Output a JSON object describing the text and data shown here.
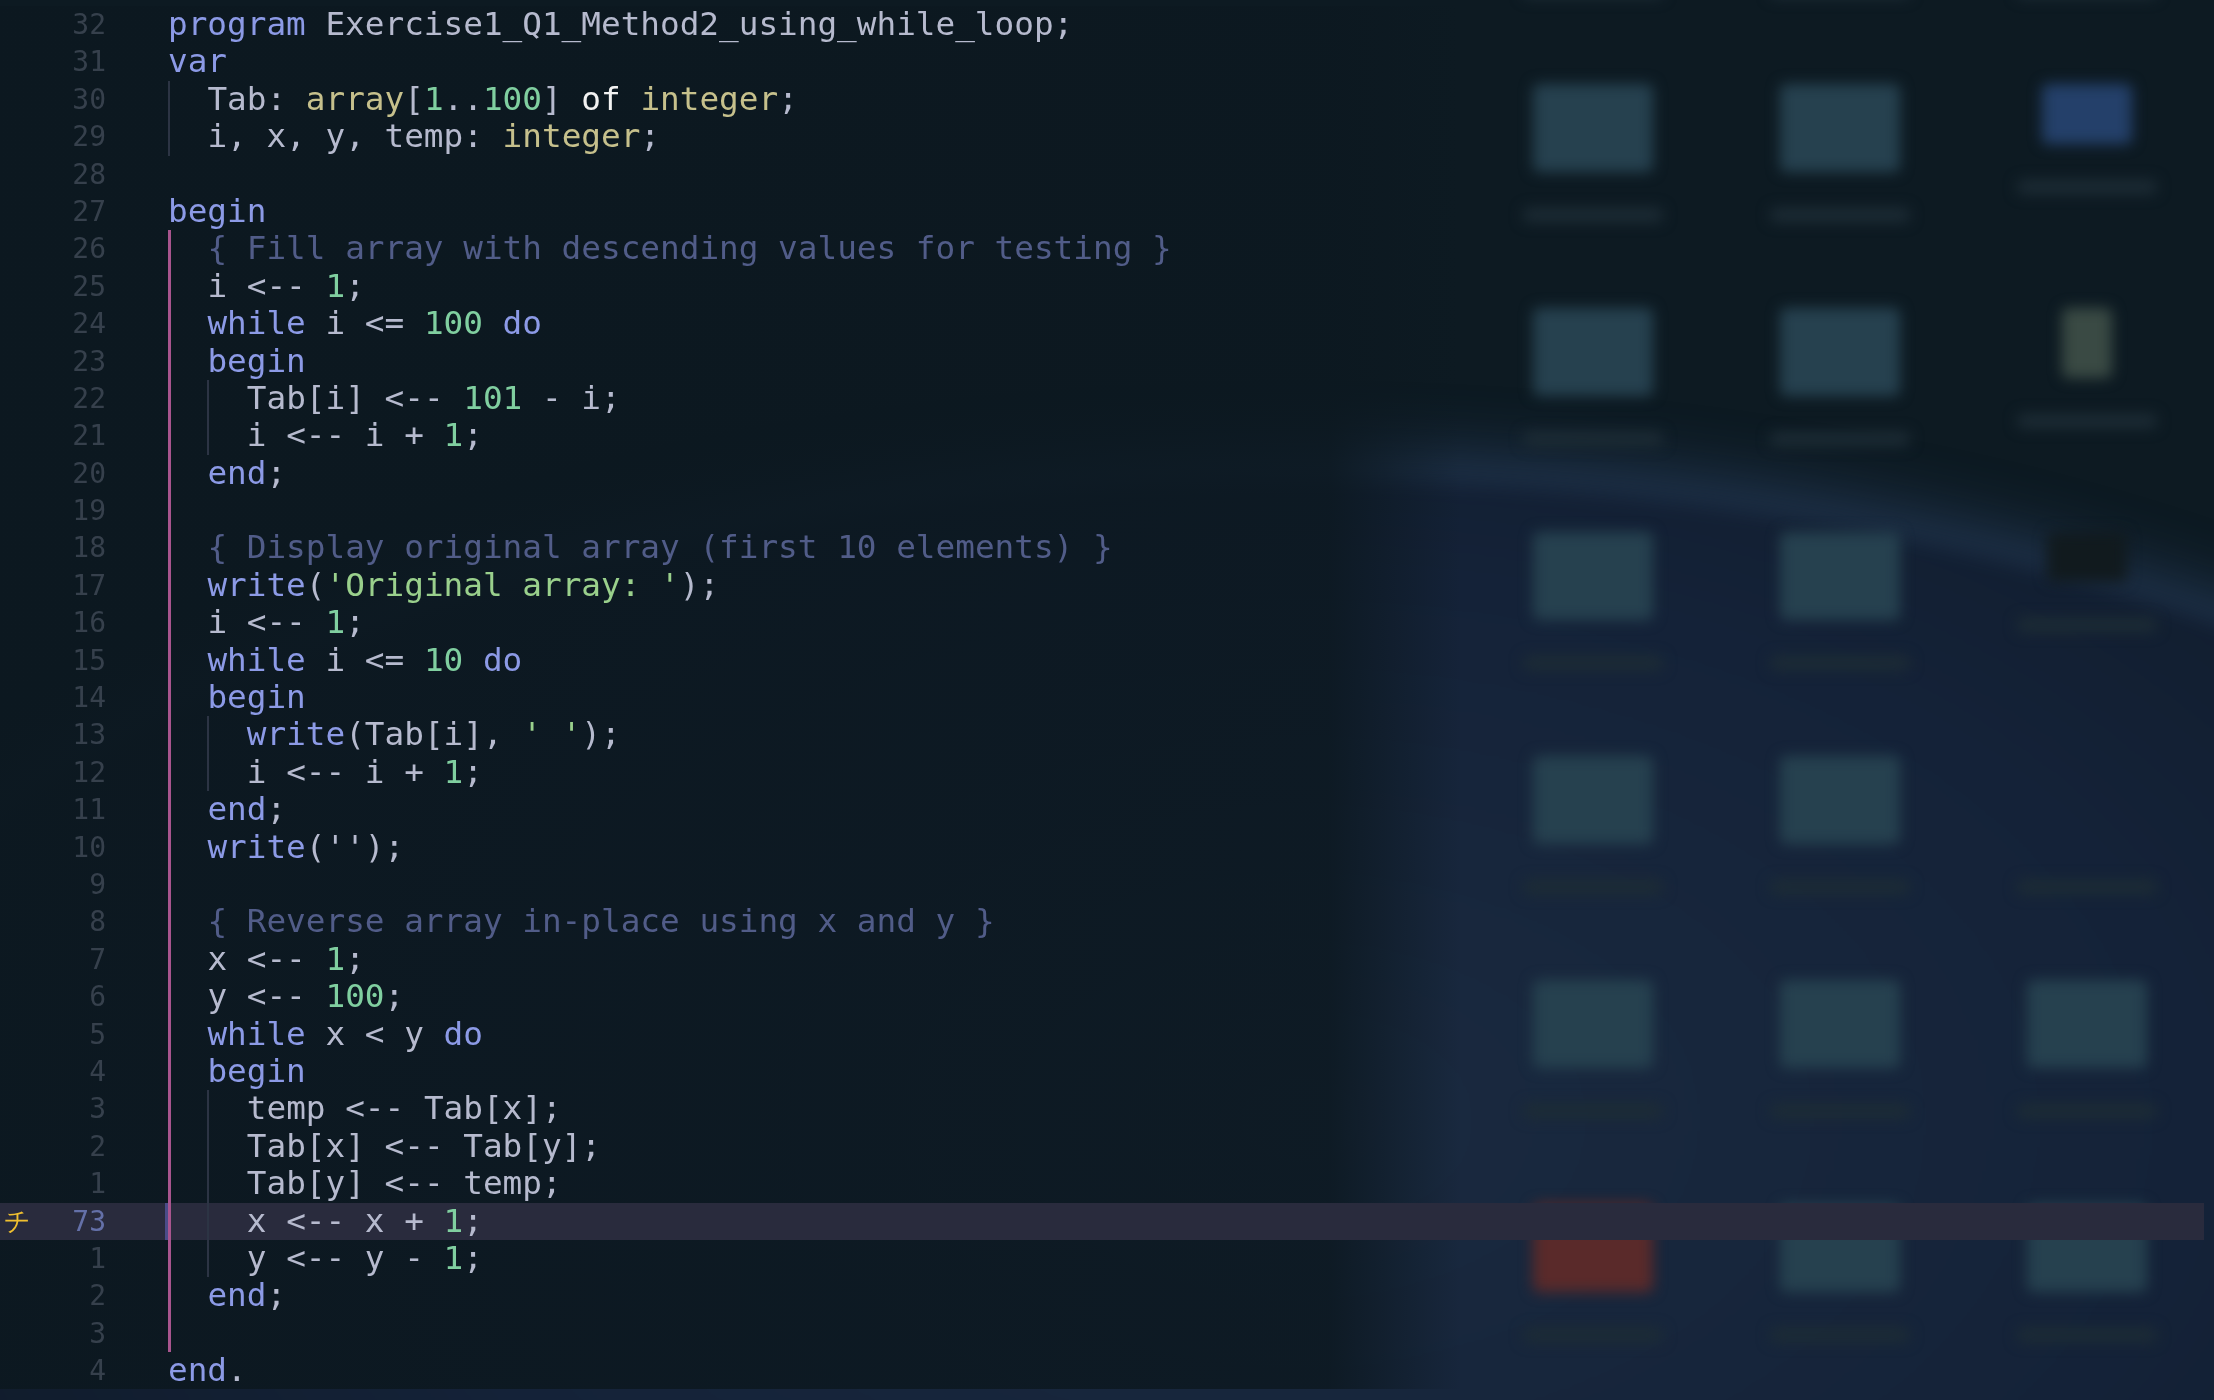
{
  "editor": {
    "lines": [
      {
        "number": "32",
        "selected": false,
        "kind": "top",
        "tokens": [
          {
            "kind": "keyword",
            "text": "program"
          },
          {
            "kind": "ident",
            "text": " Exercise1_Q1_Method2_using_while_loop;"
          }
        ]
      },
      {
        "number": "31",
        "selected": false,
        "kind": "top",
        "tokens": [
          {
            "kind": "keyword",
            "text": "var"
          }
        ]
      },
      {
        "number": "30",
        "selected": false,
        "kind": "decl",
        "tokens": [
          {
            "kind": "ident",
            "text": "Tab: "
          },
          {
            "kind": "type",
            "text": "array"
          },
          {
            "kind": "ident",
            "text": "["
          },
          {
            "kind": "number",
            "text": "1"
          },
          {
            "kind": "ident",
            "text": ".."
          },
          {
            "kind": "number",
            "text": "100"
          },
          {
            "kind": "ident",
            "text": "] "
          },
          {
            "kind": "special",
            "text": "of"
          },
          {
            "kind": "type",
            "text": " integer"
          },
          {
            "kind": "ident",
            "text": ";"
          }
        ]
      },
      {
        "number": "29",
        "selected": false,
        "kind": "decl",
        "tokens": [
          {
            "kind": "ident",
            "text": "i, x, y, temp: "
          },
          {
            "kind": "type",
            "text": "integer"
          },
          {
            "kind": "ident",
            "text": ";"
          }
        ]
      },
      {
        "number": "28",
        "selected": false,
        "kind": "top"
      },
      {
        "number": "27",
        "selected": false,
        "kind": "top",
        "tokens": [
          {
            "kind": "keyword",
            "text": "begin"
          }
        ]
      },
      {
        "number": "26",
        "selected": false,
        "kind": "block",
        "tokens": [
          {
            "kind": "comment",
            "text": "{ Fill array with descending values for testing }"
          }
        ]
      },
      {
        "number": "25",
        "selected": false,
        "kind": "block",
        "tokens": [
          {
            "kind": "ident",
            "text": "i <-- "
          },
          {
            "kind": "number",
            "text": "1"
          },
          {
            "kind": "ident",
            "text": ";"
          }
        ]
      },
      {
        "number": "24",
        "selected": false,
        "kind": "block",
        "tokens": [
          {
            "kind": "keyword",
            "text": "while"
          },
          {
            "kind": "ident",
            "text": " i <= "
          },
          {
            "kind": "number",
            "text": "100"
          },
          {
            "kind": "keyword",
            "text": " do"
          }
        ]
      },
      {
        "number": "23",
        "selected": false,
        "kind": "block",
        "tokens": [
          {
            "kind": "keyword",
            "text": "begin"
          }
        ]
      },
      {
        "number": "22",
        "selected": false,
        "kind": "inner",
        "tokens": [
          {
            "kind": "ident",
            "text": "Tab[i] <-- "
          },
          {
            "kind": "number",
            "text": "101"
          },
          {
            "kind": "ident",
            "text": " - i;"
          }
        ]
      },
      {
        "number": "21",
        "selected": false,
        "kind": "inner",
        "tokens": [
          {
            "kind": "ident",
            "text": "i <-- i + "
          },
          {
            "kind": "number",
            "text": "1"
          },
          {
            "kind": "ident",
            "text": ";"
          }
        ]
      },
      {
        "number": "20",
        "selected": false,
        "kind": "block",
        "tokens": [
          {
            "kind": "keyword",
            "text": "end"
          },
          {
            "kind": "ident",
            "text": ";"
          }
        ]
      },
      {
        "number": "19",
        "selected": false,
        "kind": "block"
      },
      {
        "number": "18",
        "selected": false,
        "kind": "block",
        "tokens": [
          {
            "kind": "comment",
            "text": "{ Display original array (first 10 elements) }"
          }
        ]
      },
      {
        "number": "17",
        "selected": false,
        "kind": "block",
        "tokens": [
          {
            "kind": "keyword",
            "text": "write"
          },
          {
            "kind": "ident",
            "text": "("
          },
          {
            "kind": "string",
            "text": "'Original array: '"
          },
          {
            "kind": "ident",
            "text": ");"
          }
        ]
      },
      {
        "number": "16",
        "selected": false,
        "kind": "block",
        "tokens": [
          {
            "kind": "ident",
            "text": "i <-- "
          },
          {
            "kind": "number",
            "text": "1"
          },
          {
            "kind": "ident",
            "text": ";"
          }
        ]
      },
      {
        "number": "15",
        "selected": false,
        "kind": "block",
        "tokens": [
          {
            "kind": "keyword",
            "text": "while"
          },
          {
            "kind": "ident",
            "text": " i <= "
          },
          {
            "kind": "number",
            "text": "10"
          },
          {
            "kind": "keyword",
            "text": " do"
          }
        ]
      },
      {
        "number": "14",
        "selected": false,
        "kind": "block",
        "tokens": [
          {
            "kind": "keyword",
            "text": "begin"
          }
        ]
      },
      {
        "number": "13",
        "selected": false,
        "kind": "inner",
        "tokens": [
          {
            "kind": "keyword",
            "text": "write"
          },
          {
            "kind": "ident",
            "text": "(Tab[i], "
          },
          {
            "kind": "string",
            "text": "' '"
          },
          {
            "kind": "ident",
            "text": ");"
          }
        ]
      },
      {
        "number": "12",
        "selected": false,
        "kind": "inner",
        "tokens": [
          {
            "kind": "ident",
            "text": "i <-- i + "
          },
          {
            "kind": "number",
            "text": "1"
          },
          {
            "kind": "ident",
            "text": ";"
          }
        ]
      },
      {
        "number": "11",
        "selected": false,
        "kind": "block",
        "tokens": [
          {
            "kind": "keyword",
            "text": "end"
          },
          {
            "kind": "ident",
            "text": ";"
          }
        ]
      },
      {
        "number": "10",
        "selected": false,
        "kind": "block",
        "tokens": [
          {
            "kind": "keyword",
            "text": "write"
          },
          {
            "kind": "ident",
            "text": "('');"
          }
        ]
      },
      {
        "number": "9",
        "selected": false,
        "kind": "block"
      },
      {
        "number": "8",
        "selected": false,
        "kind": "block",
        "tokens": [
          {
            "kind": "comment",
            "text": "{ Reverse array in-place using x and y }"
          }
        ]
      },
      {
        "number": "7",
        "selected": false,
        "kind": "block",
        "tokens": [
          {
            "kind": "ident",
            "text": "x <-- "
          },
          {
            "kind": "number",
            "text": "1"
          },
          {
            "kind": "ident",
            "text": ";"
          }
        ]
      },
      {
        "number": "6",
        "selected": false,
        "kind": "block",
        "tokens": [
          {
            "kind": "ident",
            "text": "y <-- "
          },
          {
            "kind": "number",
            "text": "100"
          },
          {
            "kind": "ident",
            "text": ";"
          }
        ]
      },
      {
        "number": "5",
        "selected": false,
        "kind": "block",
        "tokens": [
          {
            "kind": "keyword",
            "text": "while"
          },
          {
            "kind": "ident",
            "text": " x < y "
          },
          {
            "kind": "keyword",
            "text": "do"
          }
        ]
      },
      {
        "number": "4",
        "selected": false,
        "kind": "block",
        "tokens": [
          {
            "kind": "keyword",
            "text": "begin"
          }
        ]
      },
      {
        "number": "3",
        "selected": false,
        "kind": "inner",
        "tokens": [
          {
            "kind": "ident",
            "text": "temp <-- Tab[x];"
          }
        ]
      },
      {
        "number": "2",
        "selected": false,
        "kind": "inner",
        "tokens": [
          {
            "kind": "ident",
            "text": "Tab[x] <-- Tab[y];"
          }
        ]
      },
      {
        "number": "1",
        "selected": false,
        "kind": "inner",
        "tokens": [
          {
            "kind": "ident",
            "text": "Tab[y] <-- temp;"
          }
        ]
      },
      {
        "number": "73",
        "selected": true,
        "sign": "チ",
        "kind": "inner",
        "tokens": [
          {
            "kind": "ident",
            "text": "x <-- x + "
          },
          {
            "kind": "number",
            "text": "1"
          },
          {
            "kind": "ident",
            "text": ";"
          }
        ]
      },
      {
        "number": "1",
        "selected": false,
        "kind": "inner",
        "tokens": [
          {
            "kind": "ident",
            "text": "y <-- y - "
          },
          {
            "kind": "number",
            "text": "1"
          },
          {
            "kind": "ident",
            "text": ";"
          }
        ]
      },
      {
        "number": "2",
        "selected": false,
        "kind": "block",
        "tokens": [
          {
            "kind": "keyword",
            "text": "end"
          },
          {
            "kind": "ident",
            "text": ";"
          }
        ]
      },
      {
        "number": "3",
        "selected": false,
        "kind": "block"
      },
      {
        "number": "4",
        "selected": false,
        "kind": "top",
        "tokens": [
          {
            "kind": "keyword",
            "text": "end"
          },
          {
            "kind": "ident",
            "text": "."
          }
        ]
      }
    ]
  }
}
